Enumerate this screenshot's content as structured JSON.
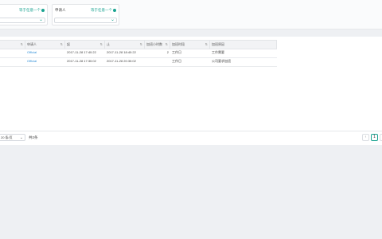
{
  "filters": [
    {
      "label": "",
      "option": "等于任意一个",
      "value": ""
    },
    {
      "label": "申请人",
      "option": "等于任意一个",
      "value": ""
    }
  ],
  "table": {
    "columns": [
      "",
      "申请人",
      "起",
      "止",
      "加班小时数",
      "加班时段",
      "加班原因"
    ],
    "rows": [
      [
        "",
        "Official",
        "2017-11-28 17:40:22",
        "2017-11-28 18:40:22",
        "2",
        "工作日",
        "工作需要"
      ],
      [
        "",
        "Official",
        "2017-11-28 17:30:02",
        "2017-11-28 20:30:02",
        "",
        "工作日",
        "公司要求加班"
      ]
    ]
  },
  "pager": {
    "page_size": "20 条/页",
    "total": "共2条",
    "current_page": "1",
    "prev_icon": "chevron-left-icon",
    "next_icon": "chevron-right-icon"
  },
  "colors": {
    "accent": "#1aa391",
    "link": "#2f8fd8",
    "background": "#eef0f3"
  }
}
